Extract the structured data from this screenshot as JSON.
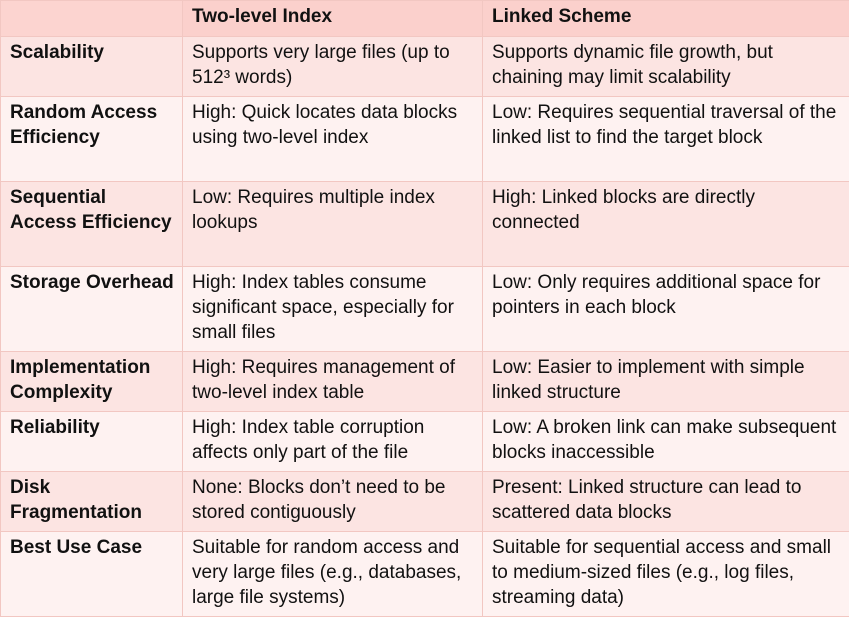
{
  "table": {
    "headers": [
      "",
      "Two-level Index",
      "Linked Scheme"
    ],
    "rows": [
      {
        "label": "Scalability",
        "two_level": "Supports very large files (up to 512³ words)",
        "linked": "Supports dynamic file growth, but chaining may limit scalability"
      },
      {
        "label": "Random Access Efficiency",
        "two_level": "High: Quick locates data blocks using two-level index",
        "linked": "Low: Requires sequential traversal of the linked list to find the target block"
      },
      {
        "label": "Sequential Access Efficiency",
        "two_level": "Low: Requires multiple index lookups",
        "linked": "High: Linked blocks are directly connected"
      },
      {
        "label": "Storage Overhead",
        "two_level": "High: Index tables consume significant space, especially for small files",
        "linked": "Low: Only requires additional space for pointers in each block"
      },
      {
        "label": "Implementation Complexity",
        "two_level": "High: Requires management of two-level index table",
        "linked": "Low: Easier to implement with simple linked structure"
      },
      {
        "label": "Reliability",
        "two_level": "High: Index table corruption affects only part of the file",
        "linked": "Low: A broken link can make subsequent blocks inaccessible"
      },
      {
        "label": "Disk Fragmentation",
        "two_level": "None: Blocks don’t need to be stored contiguously",
        "linked": "Present: Linked structure can lead to scattered data blocks"
      },
      {
        "label": "Best Use Case",
        "two_level": "Suitable for random access and very large files (e.g., databases, large file systems)",
        "linked": "Suitable for sequential access and small to medium-sized files (e.g., log files, streaming data)"
      }
    ]
  }
}
